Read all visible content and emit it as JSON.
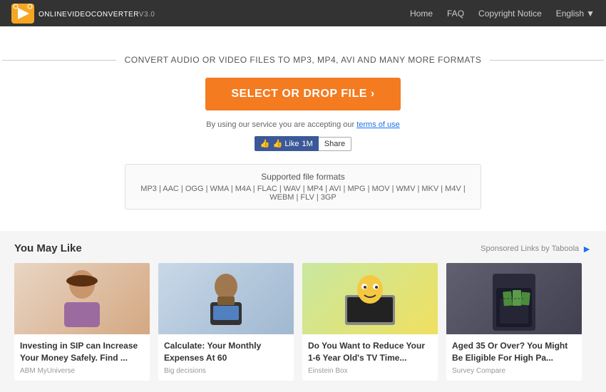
{
  "header": {
    "logo_text": "OnlineVideoConverter",
    "logo_version": "v3.0",
    "nav": {
      "home": "Home",
      "faq": "FAQ",
      "copyright": "Copyright Notice",
      "language": "English",
      "lang_arrow": "▼"
    }
  },
  "main": {
    "subtitle": "CONVERT AUDIO OR VIDEO FILES TO MP3, MP4, AVI AND MANY MORE FORMATS",
    "select_btn": "SELECT OR DROP FILE  ›",
    "terms_text": "By using our service you are accepting our",
    "terms_link": "terms of use",
    "fb_like": "👍 Like",
    "fb_count": "1M",
    "fb_share": "Share",
    "formats_title": "Supported file formats",
    "formats_list": "MP3 | AAC | OGG | WMA | M4A | FLAC | WAV | MP4 | AVI | MPG | MOV | WMV | MKV | M4V | WEBM | FLV | 3GP"
  },
  "recommendations": {
    "title": "You May Like",
    "sponsored": "Sponsored Links by Taboola",
    "cards": [
      {
        "id": 1,
        "title": "Investing in SIP can Increase Your Money Safely. Find ...",
        "source": "ABM MyUniverse",
        "emoji": "👩"
      },
      {
        "id": 2,
        "title": "Calculate: Your Monthly Expenses At 60",
        "source": "Big decisions",
        "emoji": "💼"
      },
      {
        "id": 3,
        "title": "Do You Want to Reduce Your 1-6 Year Old's TV Time...",
        "source": "Einstein Box",
        "emoji": "📺"
      },
      {
        "id": 4,
        "title": "Aged 35 Or Over? You Might Be Eligible For High Pa...",
        "source": "Survey Compare",
        "emoji": "💰"
      }
    ]
  }
}
